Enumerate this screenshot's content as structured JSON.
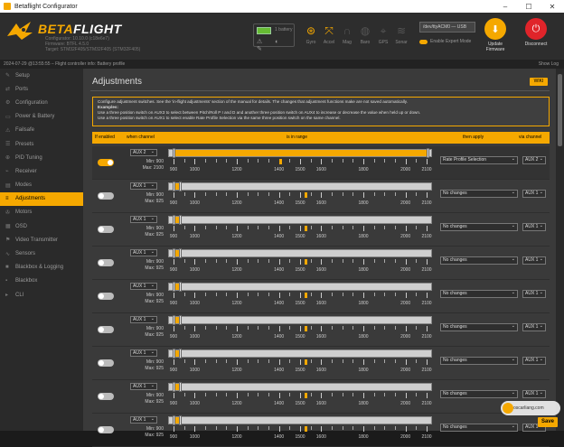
{
  "window": {
    "title": "Betaflight Configurator",
    "min": "–",
    "max": "☐",
    "close": "✕"
  },
  "brand": {
    "name_a": "BETA",
    "name_b": "FLIGHT",
    "info": [
      "Configurator: 10.10.0 (c18e6e7)",
      "Firmware: BTFL 4.5.0",
      "Target: STM32F405/STM32F405 (STM32F405)"
    ]
  },
  "battery": {
    "label": "1 battery",
    "icons": "⚠ ◐ ✎"
  },
  "sensors": [
    {
      "label": "Gyro",
      "icon": "gyro-icon",
      "glyph": "⊛",
      "on": true
    },
    {
      "label": "Accel",
      "icon": "accel-icon",
      "glyph": "⤧",
      "on": true
    },
    {
      "label": "Mag",
      "icon": "mag-icon",
      "glyph": "∩",
      "on": false
    },
    {
      "label": "Baro",
      "icon": "baro-icon",
      "glyph": "◍",
      "on": false
    },
    {
      "label": "GPS",
      "icon": "gps-icon",
      "glyph": "⌖",
      "on": false
    },
    {
      "label": "Sonar",
      "icon": "sonar-icon",
      "glyph": "≋",
      "on": false
    }
  ],
  "connection": {
    "port": "/dev/ttyACM0 — USB",
    "toggle_label": "Enable Expert Mode"
  },
  "buttons": {
    "update": "Update Firmware",
    "disconnect": "Disconnect"
  },
  "status": {
    "left": "2024-07-29 @13:55:55 – Flight controller info: Battery profile",
    "right": "Show Log"
  },
  "nav": [
    {
      "label": "Setup",
      "icon": "wrench-icon",
      "glyph": "✎"
    },
    {
      "label": "Ports",
      "icon": "ports-icon",
      "glyph": "⇄"
    },
    {
      "label": "Configuration",
      "icon": "gear-icon",
      "glyph": "⚙"
    },
    {
      "label": "Power & Battery",
      "icon": "battery-icon",
      "glyph": "▭"
    },
    {
      "label": "Failsafe",
      "icon": "failsafe-icon",
      "glyph": "⚠"
    },
    {
      "label": "Presets",
      "icon": "presets-icon",
      "glyph": "☰"
    },
    {
      "label": "PID Tuning",
      "icon": "pid-icon",
      "glyph": "⊕"
    },
    {
      "label": "Receiver",
      "icon": "receiver-icon",
      "glyph": "⌁"
    },
    {
      "label": "Modes",
      "icon": "modes-icon",
      "glyph": "▤"
    },
    {
      "label": "Adjustments",
      "icon": "adjustments-icon",
      "glyph": "≡",
      "active": true
    },
    {
      "label": "Motors",
      "icon": "motors-icon",
      "glyph": "✇"
    },
    {
      "label": "OSD",
      "icon": "osd-icon",
      "glyph": "▦"
    },
    {
      "label": "Video Transmitter",
      "icon": "vtx-icon",
      "glyph": "⚑"
    },
    {
      "label": "Sensors",
      "icon": "sensors-icon",
      "glyph": "∿"
    },
    {
      "label": "Blackbox & Logging",
      "icon": "blackbox-icon",
      "glyph": "■"
    },
    {
      "label": "Blackbox",
      "icon": "blackbox2-icon",
      "glyph": "▪"
    },
    {
      "label": "CLI",
      "icon": "cli-icon",
      "glyph": "▸"
    }
  ],
  "page": {
    "title": "Adjustments",
    "wiki": "WIKI"
  },
  "note": {
    "line1": "Configure adjustment switches. See the 'in-flight adjustments' section of the manual for details. The changes that adjustment functions make are not saved automatically.",
    "examples": "Examples:",
    "line2": "Use a three position switch on AUX3 to select between Pitch/Roll P I and D and another three position switch on AUX4 to increase or decrease the value when held up or down.",
    "line3": "Use a three position switch on AUX1 to select enable Rate Profile Selection via the same three position switch on the same channel."
  },
  "table_head": {
    "enabled": "If enabled",
    "channel": "when channel",
    "range": "is in range",
    "apply": "then apply",
    "via": "via channel"
  },
  "rows": [
    {
      "enabled": true,
      "channel": "AUX 2",
      "min": "Min: 900",
      "max": "Max: 2100",
      "func": "Rate Profile Selection",
      "via": "AUX 2",
      "low": 0,
      "high": 1,
      "pos": 0.42
    },
    {
      "enabled": false,
      "channel": "AUX 1",
      "min": "Min: 900",
      "max": "Max: 925",
      "func": "No changes",
      "via": "AUX 1",
      "low": 0,
      "high": 0.02,
      "pos": 0.52
    },
    {
      "enabled": false,
      "channel": "AUX 1",
      "min": "Min: 900",
      "max": "Max: 925",
      "func": "No changes",
      "via": "AUX 1",
      "low": 0,
      "high": 0.02,
      "pos": 0.52
    },
    {
      "enabled": false,
      "channel": "AUX 1",
      "min": "Min: 900",
      "max": "Max: 925",
      "func": "No changes",
      "via": "AUX 1",
      "low": 0,
      "high": 0.02,
      "pos": 0.52
    },
    {
      "enabled": false,
      "channel": "AUX 1",
      "min": "Min: 900",
      "max": "Max: 925",
      "func": "No changes",
      "via": "AUX 1",
      "low": 0,
      "high": 0.02,
      "pos": 0.52
    },
    {
      "enabled": false,
      "channel": "AUX 1",
      "min": "Min: 900",
      "max": "Max: 925",
      "func": "No changes",
      "via": "AUX 1",
      "low": 0,
      "high": 0.02,
      "pos": 0.52
    },
    {
      "enabled": false,
      "channel": "AUX 1",
      "min": "Min: 900",
      "max": "Max: 925",
      "func": "No changes",
      "via": "AUX 1",
      "low": 0,
      "high": 0.02,
      "pos": 0.52
    },
    {
      "enabled": false,
      "channel": "AUX 1",
      "min": "Min: 900",
      "max": "Max: 925",
      "func": "No changes",
      "via": "AUX 1",
      "low": 0,
      "high": 0.02,
      "pos": 0.52
    },
    {
      "enabled": false,
      "channel": "AUX 1",
      "min": "Min: 900",
      "max": "Max: 925",
      "func": "No changes",
      "via": "AUX 1",
      "low": 0,
      "high": 0.02,
      "pos": 0.52
    }
  ],
  "scale": [
    "900",
    "1000",
    "1200",
    "1400",
    "1500",
    "1600",
    "1800",
    "2000",
    "2100"
  ],
  "save": "Save",
  "watermark": "oscarliang.com",
  "colors": {
    "accent": "#f5a800",
    "update": "#f5a800",
    "disconnect": "#e0242a"
  }
}
